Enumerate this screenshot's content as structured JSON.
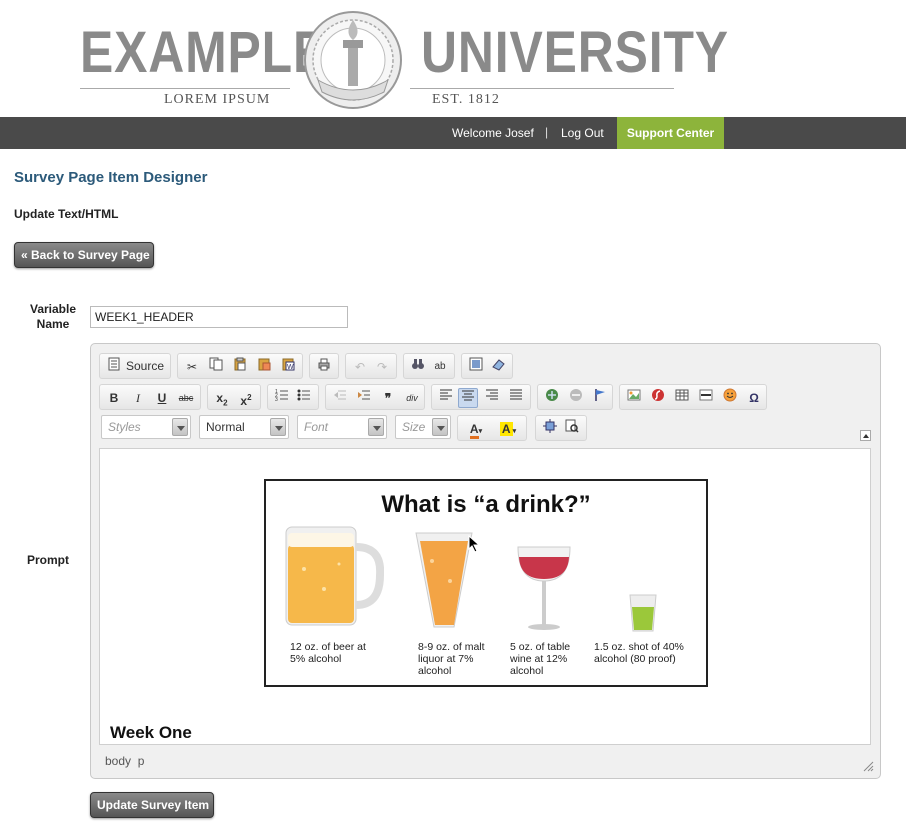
{
  "header": {
    "logo_left": "EXAMPLE",
    "logo_right": "UNIVERSITY",
    "logo_sub_left": "LOREM IPSUM",
    "logo_sub_right": "EST. 1812"
  },
  "topbar": {
    "welcome": "Welcome Josef",
    "separator": "|",
    "logout": "Log Out",
    "support": "Support Center"
  },
  "page": {
    "title": "Survey Page Item Designer",
    "subtitle": "Update Text/HTML",
    "back_button": "« Back to Survey Page",
    "variable_label": "Variable Name",
    "variable_value": "WEEK1_HEADER",
    "prompt_label": "Prompt",
    "update_button": "Update Survey Item"
  },
  "editor": {
    "source_label": "Source",
    "combo_styles": "Styles",
    "combo_format": "Normal",
    "combo_font": "Font",
    "combo_size": "Size",
    "status_path": "body  p"
  },
  "content": {
    "image_title": "What is “a drink?”",
    "captions": [
      "12 oz. of beer at 5% alcohol",
      "8-9 oz. of malt liquor at 7% alcohol",
      "5 oz. of table wine at 12% alcohol",
      "1.5 oz. shot of 40% alcohol (80 proof)"
    ],
    "heading": "Week One"
  },
  "colors": {
    "topbar": "#4a4a4a",
    "support": "#8db43b",
    "title": "#2c5a7a",
    "beer": "#f6b84a",
    "liquor": "#f3a445",
    "wine": "#c8364a",
    "shot": "#9bc83a"
  }
}
